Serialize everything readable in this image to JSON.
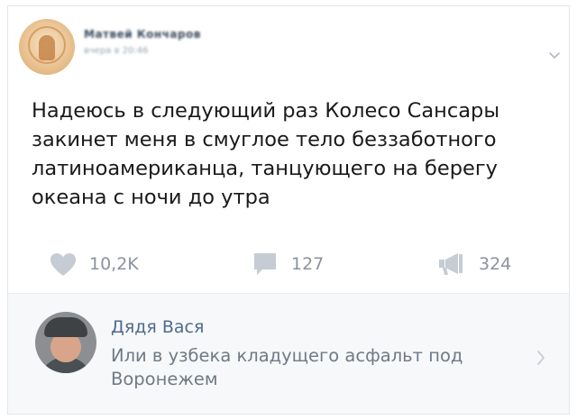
{
  "post": {
    "author": "Матвей Кончаров",
    "date": "вчера в 20:46",
    "text_lines": [
      "Надеюсь в следующий раз Колесо Сансары",
      "закинет меня в смуглое тело беззаботного",
      "латиноамериканца, танцующего на берегу",
      "океана с ночи до утра"
    ]
  },
  "actions": {
    "likes": "10,2K",
    "comments": "127",
    "shares": "324"
  },
  "comment": {
    "author": "Дядя Вася",
    "text_lines": [
      "Или в узбека кладущего асфальт под",
      "Воронежем"
    ]
  },
  "icons": {
    "post_menu": "chevron-down-icon",
    "like": "heart-icon",
    "comment": "comment-bubble-icon",
    "share": "megaphone-icon",
    "comment_open": "chevron-right-icon"
  },
  "colors": {
    "icon_gray": "#c5ccd3",
    "count_gray": "#8a939d",
    "comment_author": "#4f6b8c",
    "comment_text": "#6f7a86",
    "comment_bg": "#f7f8fa"
  }
}
